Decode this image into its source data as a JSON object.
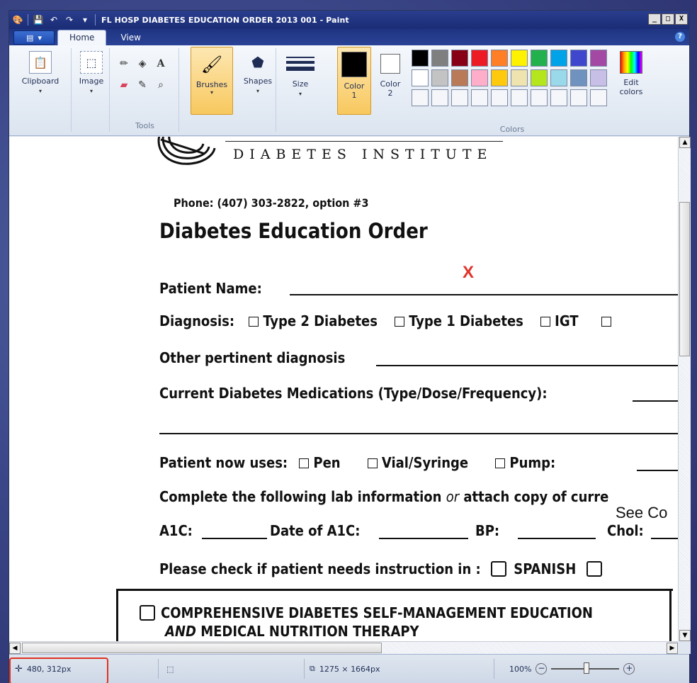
{
  "window": {
    "title": "FL HOSP DIABETES EDUCATION ORDER 2013 001 - Paint",
    "controls": [
      "_",
      "□",
      "X"
    ]
  },
  "ribbon": {
    "tabs": [
      "Home",
      "View"
    ],
    "clipboard_label": "Clipboard",
    "image_label": "Image",
    "tools_label": "Tools",
    "brushes_label": "Brushes",
    "shapes_label": "Shapes",
    "size_label": "Size",
    "color1_label": "Color",
    "color1_num": "1",
    "color2_label": "Color",
    "color2_num": "2",
    "colors_group_label": "Colors",
    "edit_colors_label": "Edit",
    "edit_colors_label2": "colors",
    "palette_row1": [
      "#000000",
      "#7f7f7f",
      "#880015",
      "#ed1c24",
      "#ff7f27",
      "#fff200",
      "#22b14c",
      "#00a2e8",
      "#3f48cc",
      "#a349a4"
    ],
    "palette_row2": [
      "#ffffff",
      "#c3c3c3",
      "#b97a57",
      "#ffaec9",
      "#ffc90e",
      "#efe4b0",
      "#b5e61d",
      "#99d9ea",
      "#7092be",
      "#c8bfe7"
    ],
    "color1": "#000000",
    "color2": "#ffffff"
  },
  "document": {
    "institute": "DIABETES INSTITUTE",
    "phone": "Phone:  (407) 303-2822, option #3",
    "heading": "Diabetes Education Order",
    "patient_name_label": "Patient Name:",
    "red_mark": "X",
    "diagnosis_label": "Diagnosis:",
    "diag_type2": "Type 2 Diabetes",
    "diag_type1": "Type 1 Diabetes",
    "diag_igt": "IGT",
    "other_diag": "Other pertinent diagnosis",
    "current_meds": "Current Diabetes Medications (Type/Dose/Frequency):",
    "uses_label": "Patient now uses:",
    "uses_pen": "Pen",
    "uses_vial": "Vial/Syringe",
    "uses_pump": "Pump:",
    "lab_prefix": "Complete the following lab information ",
    "lab_or": "or",
    "lab_suffix": " attach copy of curre",
    "a1c_label": "A1C:",
    "date_a1c_label": "Date of A1C:",
    "bp_label": "BP:",
    "chol_label": "Chol:",
    "handwritten": "See Co",
    "instruction_label": "Please check if patient needs instruction in :",
    "spanish": "SPANISH",
    "comprehensive": "COMPREHENSIVE DIABETES SELF-MANAGEMENT EDUCATION",
    "and_word": "AND",
    "mnt": " MEDICAL NUTRITION THERAPY"
  },
  "status": {
    "cursor_pos": "480, 312px",
    "image_size": "1275 × 1664px",
    "zoom": "100%"
  }
}
